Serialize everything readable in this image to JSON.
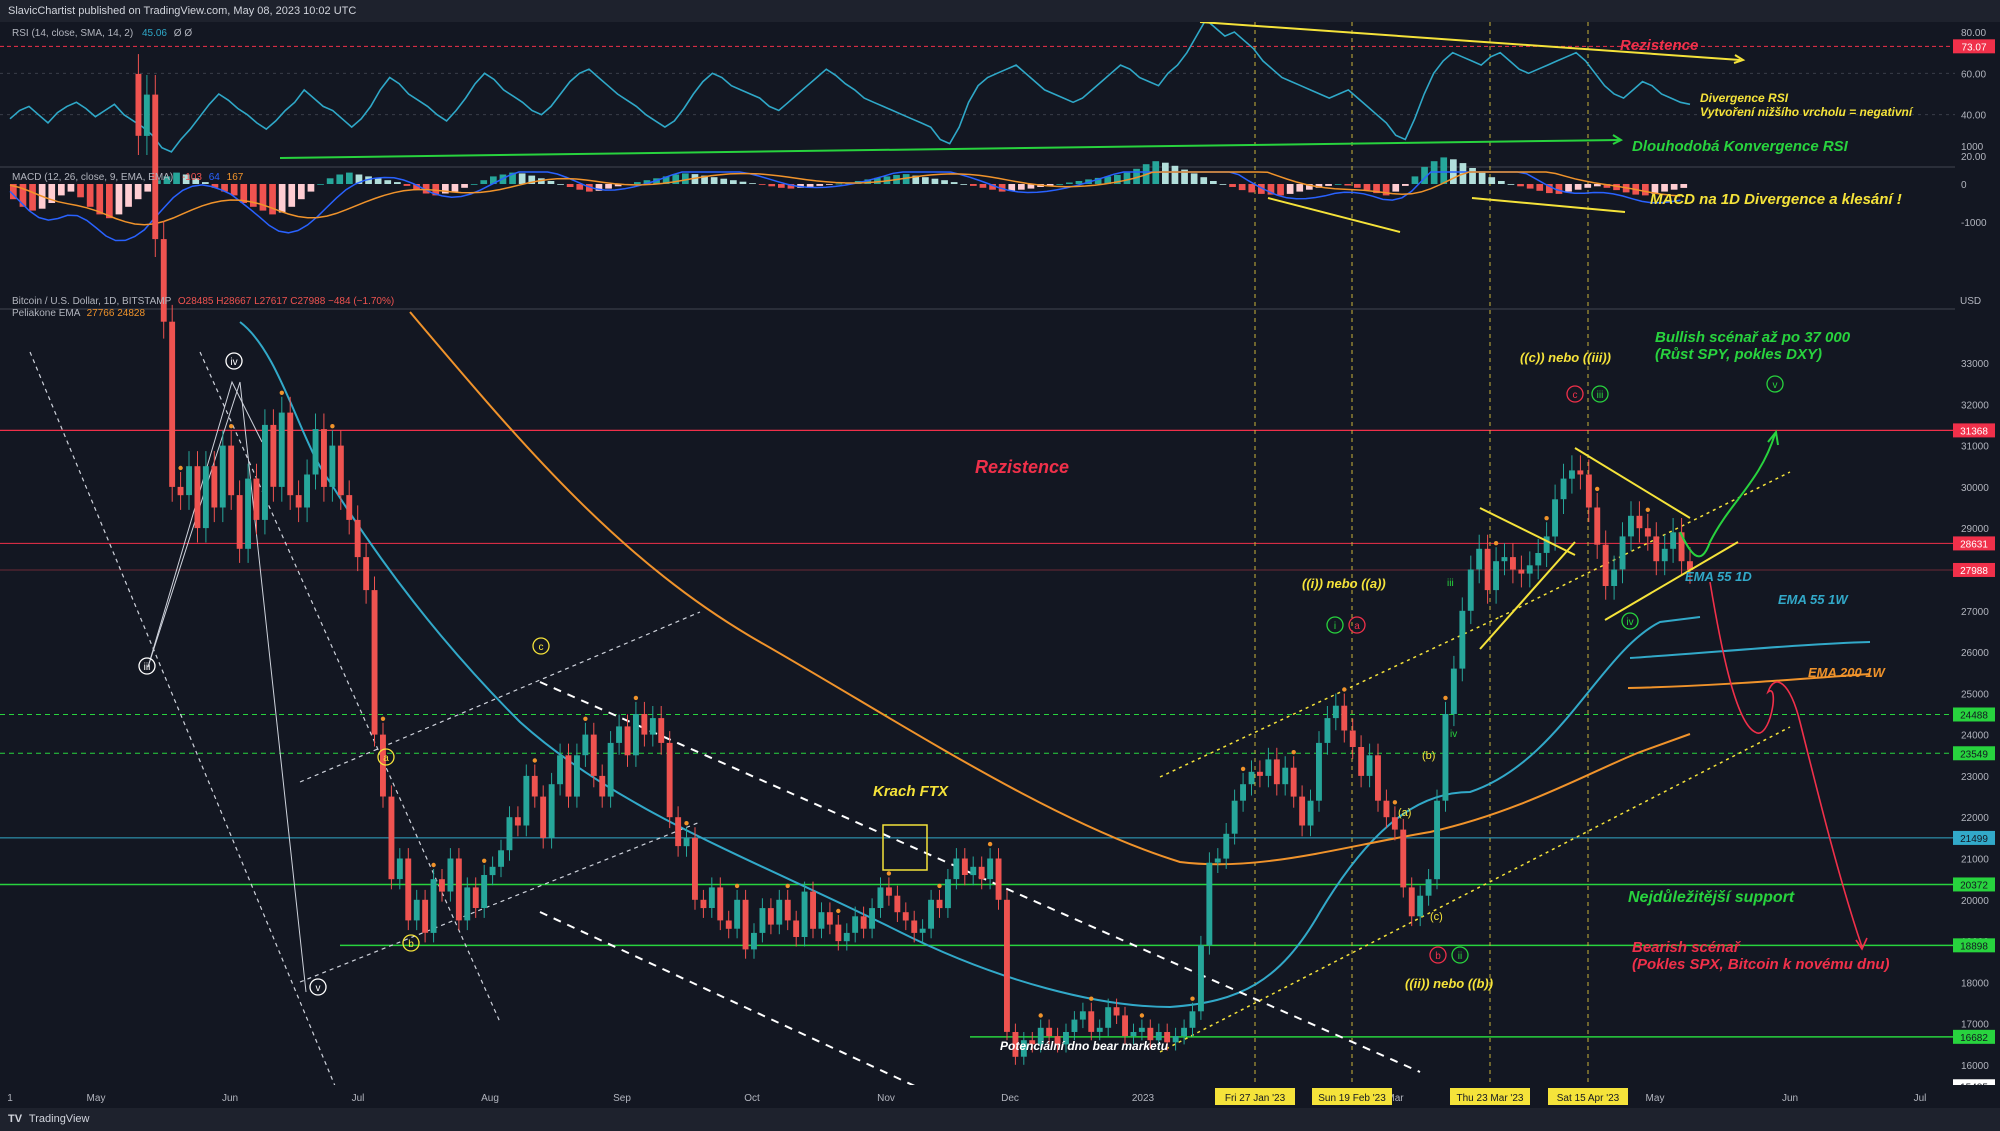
{
  "header": {
    "publisher": "SlavicChartist published on TradingView.com, May 08, 2023 10:02 UTC"
  },
  "footer": {
    "brand": "TradingView",
    "logo": "TV"
  },
  "colors": {
    "bg": "#131722",
    "rsi": "#2fa8c8",
    "ema55": "#32a9c9",
    "ema200": "#f0932b",
    "resist": "#f0304a",
    "support": "#28d33e",
    "yellow": "#f5e33a",
    "up": "#26a69a",
    "down": "#ef5350"
  },
  "rsi": {
    "legend": "RSI (14, close, SMA, 14, 2)",
    "value": "45.06",
    "extra": "Ø Ø",
    "ticks": [
      "80.00",
      "60.00",
      "40.00",
      "20.00"
    ],
    "badge": "73.07",
    "annotations": {
      "resistance": "Rezistence",
      "divergence_1": "Divergence RSI",
      "divergence_2": "Vytvoření nižšího vrcholu = negativní",
      "convergence": "Dlouhodobá Konvergence RSI"
    },
    "values": [
      38,
      42,
      44,
      40,
      36,
      41,
      44,
      46,
      43,
      39,
      42,
      45,
      40,
      37,
      34,
      30,
      24,
      22,
      28,
      33,
      39,
      45,
      50,
      47,
      43,
      40,
      36,
      33,
      37,
      42,
      46,
      52,
      48,
      44,
      42,
      38,
      34,
      38,
      44,
      52,
      58,
      55,
      50,
      47,
      44,
      40,
      37,
      42,
      48,
      55,
      60,
      57,
      52,
      49,
      46,
      42,
      40,
      44,
      50,
      56,
      60,
      62,
      58,
      54,
      50,
      47,
      44,
      40,
      37,
      34,
      37,
      43,
      50,
      56,
      60,
      58,
      54,
      52,
      50,
      48,
      44,
      42,
      46,
      50,
      54,
      58,
      62,
      59,
      55,
      52,
      48,
      46,
      44,
      42,
      40,
      38,
      36,
      34,
      28,
      26,
      34,
      46,
      54,
      58,
      60,
      62,
      64,
      60,
      56,
      52,
      50,
      48,
      46,
      48,
      52,
      56,
      60,
      64,
      62,
      58,
      56,
      54,
      60,
      64,
      70,
      78,
      86,
      82,
      78,
      80,
      76,
      72,
      66,
      62,
      58,
      56,
      54,
      52,
      50,
      48,
      50,
      52,
      48,
      44,
      40,
      36,
      30,
      28,
      38,
      50,
      60,
      66,
      70,
      68,
      66,
      64,
      68,
      70,
      66,
      62,
      60,
      62,
      64,
      66,
      68,
      70,
      66,
      60,
      54,
      50,
      48,
      52,
      56,
      54,
      50,
      48,
      46,
      45
    ]
  },
  "macd": {
    "legend": "MACD (12, 26, close, 9, EMA, EMA)",
    "v1": "-103",
    "v2": "64",
    "v3": "167",
    "ticks": [
      "1000",
      "0",
      "-1000"
    ],
    "annotation": "MACD na 1D Divergence a klesání !",
    "hist": [
      -400,
      -600,
      -700,
      -650,
      -500,
      -300,
      -200,
      -350,
      -600,
      -800,
      -900,
      -800,
      -600,
      -400,
      -200,
      100,
      200,
      300,
      250,
      150,
      50,
      -100,
      -200,
      -300,
      -500,
      -600,
      -700,
      -800,
      -750,
      -600,
      -400,
      -200,
      0,
      150,
      250,
      300,
      250,
      200,
      150,
      100,
      50,
      -50,
      -150,
      -250,
      -300,
      -250,
      -200,
      -100,
      0,
      100,
      200,
      250,
      300,
      280,
      220,
      150,
      80,
      0,
      -80,
      -150,
      -200,
      -180,
      -120,
      -60,
      0,
      50,
      100,
      150,
      200,
      250,
      280,
      260,
      220,
      180,
      140,
      100,
      60,
      20,
      -20,
      -60,
      -100,
      -120,
      -100,
      -80,
      -50,
      -20,
      10,
      40,
      80,
      120,
      160,
      200,
      240,
      260,
      220,
      180,
      140,
      100,
      50,
      0,
      -50,
      -100,
      -150,
      -200,
      -180,
      -150,
      -120,
      -80,
      -40,
      0,
      40,
      80,
      120,
      160,
      200,
      240,
      300,
      400,
      520,
      600,
      560,
      480,
      380,
      280,
      180,
      80,
      0,
      -80,
      -160,
      -220,
      -260,
      -280,
      -300,
      -260,
      -200,
      -150,
      -100,
      -50,
      0,
      -40,
      -100,
      -160,
      -240,
      -300,
      -200,
      -50,
      200,
      450,
      600,
      700,
      650,
      550,
      420,
      300,
      180,
      80,
      0,
      -60,
      -120,
      -180,
      -240,
      -260,
      -200,
      -150,
      -100,
      -60,
      -100,
      -160,
      -220,
      -280,
      -300,
      -260,
      -200,
      -150,
      -103
    ]
  },
  "price": {
    "legend": "Bitcoin / U.S. Dollar, 1D, BITSTAMP",
    "ohlc": "O28485 H28667 L27617 C27988 −484 (−1.70%)",
    "ema_legend": "Peliakone EMA",
    "ema_vals": "27766 24828",
    "unit": "USD",
    "y_ticks": [
      "33000",
      "32000",
      "31000",
      "30000",
      "29000",
      "28000",
      "27000",
      "26000",
      "25000",
      "24000",
      "23000",
      "22000",
      "21000",
      "20000",
      "19000",
      "18000",
      "17000",
      "16000"
    ],
    "badges": {
      "r31368": "31368",
      "r28631": "28631",
      "r27988": "27988",
      "g24488": "24488",
      "g23549": "23549",
      "c21499": "21499",
      "g20372": "20372",
      "g18898": "18898",
      "g16682": "16682",
      "w15485": "15485"
    },
    "x_labels": [
      "1",
      "May",
      "Jun",
      "Jul",
      "Aug",
      "Sep",
      "Oct",
      "Nov",
      "Dec",
      "2023",
      "Mar",
      "May",
      "Jun",
      "Jul"
    ],
    "x_highlights": [
      "Fri 27 Jan '23",
      "Sun 19 Feb '23",
      "Thu 23 Mar '23",
      "Sat 15 Apr '23"
    ],
    "annotations": {
      "resistance": "Rezistence",
      "bullish_1": "Bullish scénař až po 37 000",
      "bullish_2": "(Růst SPY, pokles DXY)",
      "c_or_iii": "((c)) nebo ((iii))",
      "i_or_a": "((i)) nebo ((a))",
      "ii_or_b": "((ii)) nebo ((b))",
      "ema55_1d": "EMA 55 1D",
      "ema55_1w": "EMA 55 1W",
      "ema200_1w": "EMA 200 1W",
      "support": "Nejdůležitější support",
      "bearish_1": "Bearish scénař",
      "bearish_2": "(Pokles SPX, Bitcoin k novému dnu)",
      "ftx": "Krach FTX",
      "bottom": "Potenciální dno bear marketu"
    },
    "waves": {
      "iii": "iii",
      "iv": "iv",
      "v": "v",
      "a": "a",
      "b": "b",
      "c": "c",
      "A": "(a)",
      "B": "(b)",
      "C": "(c)",
      "ii": "ii",
      "i": "i",
      "iii2": "iii",
      "iv2": "iv",
      "v2": "v",
      "iv3": "iv",
      "pa": "a",
      "pb": "b",
      "pc": "c"
    },
    "closes": [
      40000,
      38500,
      39500,
      36000,
      34000,
      30000,
      29800,
      30500,
      29000,
      30500,
      29500,
      31000,
      29800,
      28500,
      30200,
      29200,
      31500,
      30000,
      31800,
      29800,
      29500,
      30300,
      31400,
      30000,
      31000,
      29800,
      29200,
      28300,
      27500,
      24000,
      22500,
      20500,
      21000,
      19500,
      20000,
      19200,
      20500,
      20200,
      21000,
      19500,
      20300,
      19800,
      20600,
      20800,
      21200,
      22000,
      21800,
      23000,
      22500,
      21500,
      22800,
      23500,
      22500,
      23500,
      24000,
      23000,
      22500,
      23800,
      24200,
      23500,
      24500,
      24000,
      24400,
      23800,
      22000,
      21300,
      21500,
      20000,
      19800,
      20300,
      19500,
      19300,
      20000,
      18800,
      19200,
      19800,
      19400,
      20000,
      19500,
      19100,
      20200,
      19300,
      19700,
      19400,
      19000,
      19200,
      19600,
      19300,
      19800,
      20300,
      20100,
      19700,
      19500,
      19200,
      19300,
      20000,
      19800,
      20500,
      21000,
      20600,
      20800,
      20500,
      21000,
      20000,
      16800,
      16200,
      16600,
      16500,
      16900,
      16700,
      16500,
      16800,
      17100,
      17300,
      16800,
      16900,
      17400,
      17200,
      16700,
      16800,
      16900,
      16600,
      16800,
      16550,
      16700,
      16900,
      17300,
      18900,
      20900,
      21000,
      21600,
      22400,
      22800,
      23100,
      23000,
      23400,
      22800,
      23200,
      22500,
      21800,
      22400,
      23800,
      24400,
      24700,
      24100,
      23700,
      23000,
      23500,
      22400,
      22000,
      21700,
      20300,
      19600,
      20100,
      20500,
      22400,
      24500,
      25600,
      27000,
      28000,
      28500,
      27500,
      28200,
      28300,
      28000,
      27900,
      28100,
      28400,
      28800,
      29700,
      30200,
      30400,
      30300,
      29500,
      28600,
      27600,
      28000,
      28800,
      29300,
      29000,
      28800,
      28200,
      28500,
      28900,
      28200,
      27988
    ]
  },
  "chart_data": {
    "type": "line",
    "series": [
      {
        "name": "Bitcoin / U.S. Dollar, 1D, BITSTAMP"
      },
      {
        "name": "EMA 55 1D"
      },
      {
        "name": "EMA 200 1W"
      }
    ],
    "x_range": [
      "Apr 2022",
      "Jul 2023"
    ],
    "ylim": [
      15485,
      33000
    ],
    "levels": [
      31368,
      28631,
      27988,
      24488,
      23549,
      21499,
      20372,
      18898,
      16682,
      15485
    ]
  }
}
